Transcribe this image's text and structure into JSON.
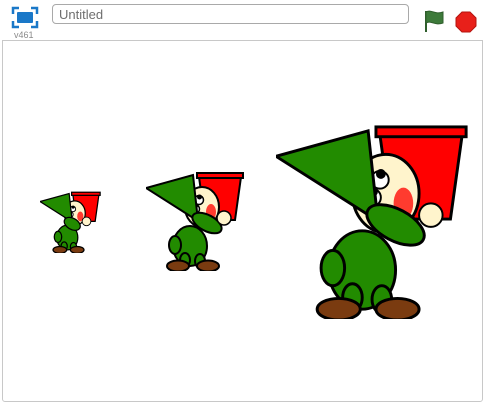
{
  "toolbar": {
    "fullscreen_icon": "fullscreen-icon",
    "version": "v461",
    "title_value": "",
    "title_placeholder": "Untitled",
    "green_flag_icon": "green-flag-icon",
    "stop_icon": "stop-icon"
  },
  "colors": {
    "flag_green": "#3d7a3a",
    "stop_red": "#e8201a",
    "fullscreen_blue": "#1a78c8",
    "hat_green": "#228b00",
    "skin": "#fff4cc",
    "pot_red": "#ff0000",
    "boot_brown": "#7a3b10"
  },
  "stage": {
    "sprites": [
      {
        "name": "gnome-small",
        "costume": "gnome-carrying-pot"
      },
      {
        "name": "gnome-medium",
        "costume": "gnome-carrying-pot"
      },
      {
        "name": "gnome-large",
        "costume": "gnome-carrying-pot"
      }
    ]
  }
}
